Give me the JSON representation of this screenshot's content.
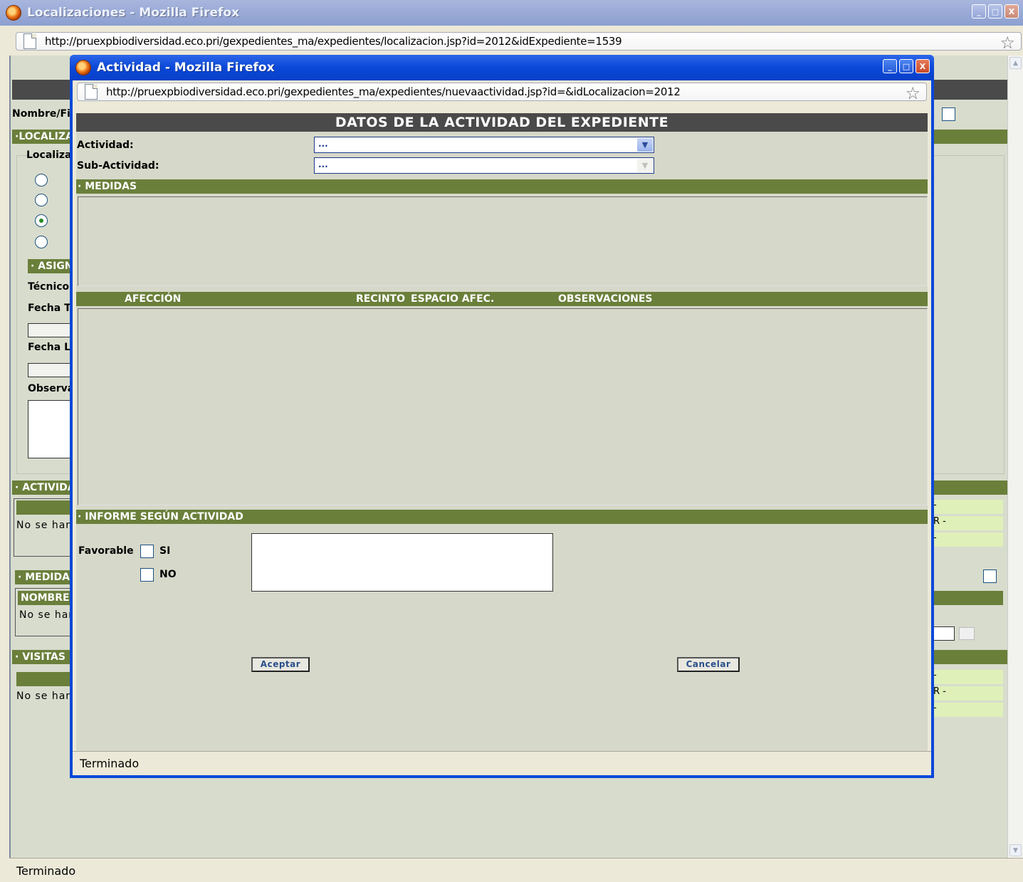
{
  "bg_window": {
    "title": "Localizaciones - Mozilla Firefox",
    "url": "http://pruexpbiodiversidad.eco.pri/gexpedientes_ma/expedientes/localizacion.jsp?id=2012&idExpediente=1539",
    "status": "Terminado",
    "labels": {
      "nombre": "Nombre/Fi",
      "localiz_bar": "·LOCALIZA",
      "localiza": "Localiza",
      "asign_bar": "· ASIGN",
      "tecnico": "Técnico:",
      "fecha_t": "Fecha T",
      "fecha_l": "Fecha Li",
      "observa": "Observa",
      "actividad_bar": "· ACTIVIDA",
      "no_se_han_1": "No se han",
      "medidas_bar": "· MEDIDAS",
      "nombre_head": "NOMBRE",
      "no_se_han_2": "No se han",
      "visitas_bar": "· VISITAS I",
      "no_se_han_3": "No se han",
      "right_frag_1": "-",
      "right_frag_2": "R -",
      "right_frag_3": "-",
      "right_frag_4": "-",
      "right_frag_5": "R -",
      "right_frag_6": "-"
    }
  },
  "popup": {
    "title": "Actividad - Mozilla Firefox",
    "url": "http://pruexpbiodiversidad.eco.pri/gexpedientes_ma/expedientes/nuevaactividad.jsp?id=&idLocalizacion=2012",
    "status": "Terminado",
    "heading": "DATOS DE LA ACTIVIDAD DEL EXPEDIENTE",
    "actividad_label": "Actividad:",
    "actividad_value": "...",
    "subactividad_label": "Sub-Actividad:",
    "subactividad_value": "...",
    "medidas_bar": "· MEDIDAS",
    "columns": {
      "afeccion": "AFECCIÓN",
      "recinto": "RECINTO",
      "espacio": "ESPACIO AFEC.",
      "observaciones": "OBSERVACIONES"
    },
    "informe_bar": "· INFORME SEGÚN ACTIVIDAD",
    "favorable_label": "Favorable",
    "si_label": "SI",
    "no_label": "NO",
    "aceptar": "Aceptar",
    "cancelar": "Cancelar"
  },
  "window_buttons": {
    "minimize": "_",
    "maximize": "□",
    "close": "X"
  },
  "colors": {
    "section_green": "#6a7f3a",
    "header_dark": "#4a4a4a",
    "xp_blue": "#0a48d9"
  },
  "icons": [
    "firefox-icon",
    "page-icon",
    "bookmark-star-icon",
    "dropdown-arrow-icon",
    "calendar-icon"
  ]
}
